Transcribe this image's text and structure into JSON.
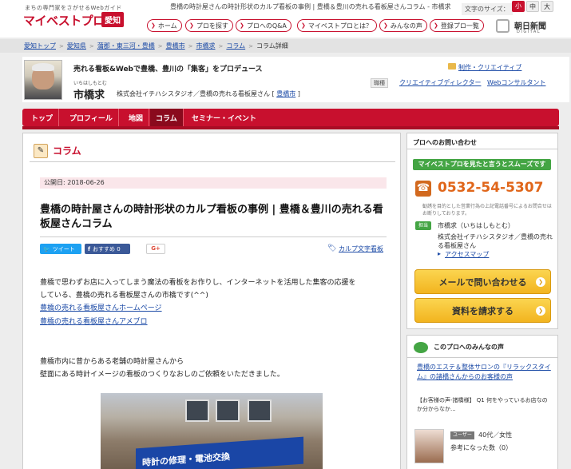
{
  "header": {
    "logo_tagline": "まちの専門家をさがせるWebガイド",
    "logo_text": "マイベストプロ",
    "logo_area": "愛知",
    "page_title": "豊橋の時計屋さんの時計形状のカルプ看板の事例 | 豊橋＆豊川の売れる看板屋さんコラム - 市橋求",
    "font_size_label": "文字のサイズ：",
    "font_sizes": [
      "小",
      "中",
      "大"
    ],
    "nav": [
      "ホーム",
      "プロを探す",
      "プロへのQ&A",
      "マイベストプロとは？",
      "みんなの声",
      "登録プロ一覧"
    ],
    "partner": "朝日新聞",
    "partner_sub": "DIGITAL"
  },
  "breadcrumb": [
    "愛知トップ",
    "愛知県",
    "蒲郡・東三河・豊橋",
    "豊橋市",
    "市橋求",
    "コラム",
    "コラム詳細"
  ],
  "profile": {
    "tagline": "売れる看板&Webで豊橋、豊川の「集客」をプロデュース",
    "name_kana": "いちはしもとむ",
    "name": "市橋求",
    "company": "株式会社イチハシスタジオ／豊橋の売れる看板屋さん",
    "city": "豊橋市",
    "category": "制作・クリエイティブ",
    "job_label": "職種",
    "jobs": [
      "クリエイティブディレクター",
      "Webコンサルタント"
    ]
  },
  "tabs": [
    "トップ",
    "プロフィール",
    "地図",
    "コラム",
    "セミナー・イベント"
  ],
  "article": {
    "section": "コラム",
    "date": "公開日: 2018-06-26",
    "title": "豊橋の時計屋さんの時計形状のカルプ看板の事例 | 豊橋＆豊川の売れる看板屋さんコラム",
    "tweet": "ツイート",
    "fb": "おすすめ 0",
    "gplus": "G+",
    "tag": "カルプ文字看板",
    "para1_line1": "豊橋で思わずお店に入ってしまう魔法の看板をお作りし、インターネットを活用した集客の応援を",
    "para1_line2": "している、豊橋の売れる看板屋さんの市橋です(^^)",
    "link1": "豊橋の売れる看板屋さんホームページ",
    "link2": "豊橋の売れる看板屋さんアメブロ",
    "para2_line1": "豊橋市内に昔からある老舗の時計屋さんから",
    "para2_line2": "壁面にある時計イメージの看板のつくりなおしのご依頼をいただきました。",
    "photo_sign": "時計の修理・電池交換"
  },
  "sidebar": {
    "contact_title": "プロへのお問い合わせ",
    "green_bar": "マイベストプロを見たと言うとスムーズです",
    "phone": "0532-54-5307",
    "note": "勧誘を目的とした営業行為の上記電話番号によるお問合せはお断りしております。",
    "owner_badge": "担当",
    "owner_name": "市橋求（いちはしもとむ）",
    "owner_company": "株式会社イチハシスタジオ／豊橋の売れる看板屋さん",
    "access": "アクセスマップ",
    "mail_btn": "メールで問い合わせる",
    "doc_btn": "資料を請求する",
    "voice_title": "このプロへのみんなの声",
    "voice_link": "豊橋のエステ＆整体サロンの『リラックスタイム』の諸橋さんからのお客様の声",
    "voice_q": "【お客様の声-諸橋様】 Q1 何をやっているお店なのか分からなか...",
    "user_badge": "ユーザー",
    "user_age": "40代／女性",
    "helpful": "参考になった数（0）"
  }
}
